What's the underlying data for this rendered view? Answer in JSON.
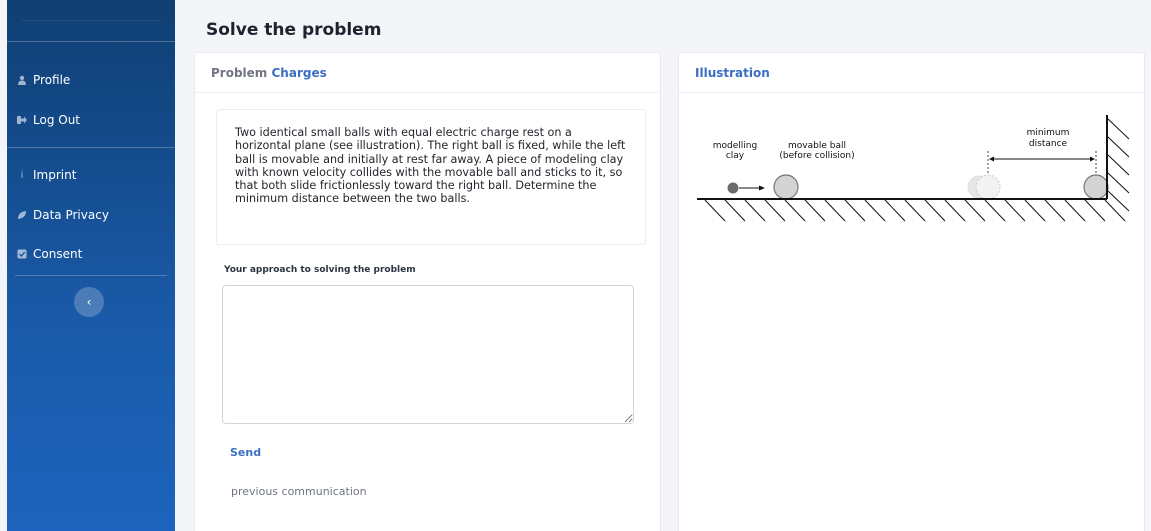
{
  "sidebar": {
    "items": [
      {
        "label": "Profile",
        "icon": "user-icon"
      },
      {
        "label": "Log Out",
        "icon": "logout-icon"
      },
      {
        "label": "Imprint",
        "icon": "info-icon"
      },
      {
        "label": "Data Privacy",
        "icon": "leaf-icon"
      },
      {
        "label": "Consent",
        "icon": "checkbox-icon"
      }
    ],
    "collapse_glyph": "‹"
  },
  "page": {
    "title": "Solve the problem"
  },
  "problem_card": {
    "header_prefix": "Problem",
    "header_topic": "Charges",
    "text": "Two identical small balls with equal electric charge rest on a horizontal plane (see illustration). The right ball is fixed, while the left ball is movable and initially at rest far away. A piece of modeling clay with known velocity collides with the movable ball and sticks to it, so that both slide frictionlessly toward the right ball. Determine the minimum distance between the two balls.",
    "approach_label": "Your approach to solving the problem",
    "approach_value": "",
    "send_label": "Send",
    "previous_label": "previous communication"
  },
  "illustration_card": {
    "header": "Illustration",
    "labels": {
      "clay_line1": "modelling",
      "clay_line2": "clay",
      "ball_line1": "movable ball",
      "ball_line2": "(before collision)",
      "dist_line1": "minimum",
      "dist_line2": "distance"
    }
  },
  "colors": {
    "sidebar_top": "#0f3f73",
    "sidebar_bottom": "#1d63bd",
    "accent": "#3b6fc4"
  }
}
